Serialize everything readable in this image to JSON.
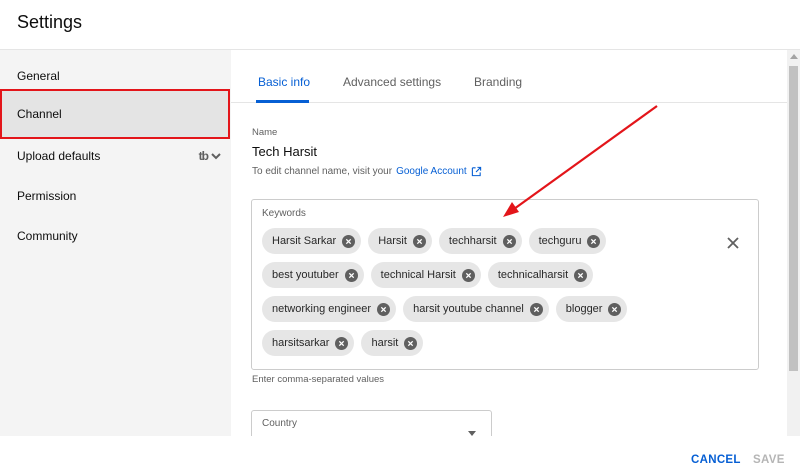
{
  "header": {
    "title": "Settings"
  },
  "sidebar": {
    "items": [
      {
        "label": "General"
      },
      {
        "label": "Channel"
      },
      {
        "label": "Upload defaults"
      },
      {
        "label": "Permission"
      },
      {
        "label": "Community"
      }
    ],
    "upload_badge": "tb"
  },
  "tabs": [
    {
      "label": "Basic info"
    },
    {
      "label": "Advanced settings"
    },
    {
      "label": "Branding"
    }
  ],
  "name": {
    "label": "Name",
    "value": "Tech Harsit",
    "hint_prefix": "To edit channel name, visit your",
    "hint_link": "Google Account"
  },
  "keywords": {
    "label": "Keywords",
    "chips": [
      "Harsit Sarkar",
      "Harsit",
      "techharsit",
      "techguru",
      "best youtuber",
      "technical Harsit",
      "technicalharsit",
      "networking engineer",
      "harsit youtube channel",
      "blogger",
      "harsitsarkar",
      "harsit"
    ],
    "hint": "Enter comma-separated values"
  },
  "country": {
    "label": "Country"
  },
  "footer": {
    "cancel": "CANCEL",
    "save": "SAVE"
  },
  "colors": {
    "accent": "#065fd4",
    "highlight": "#e3151a"
  }
}
